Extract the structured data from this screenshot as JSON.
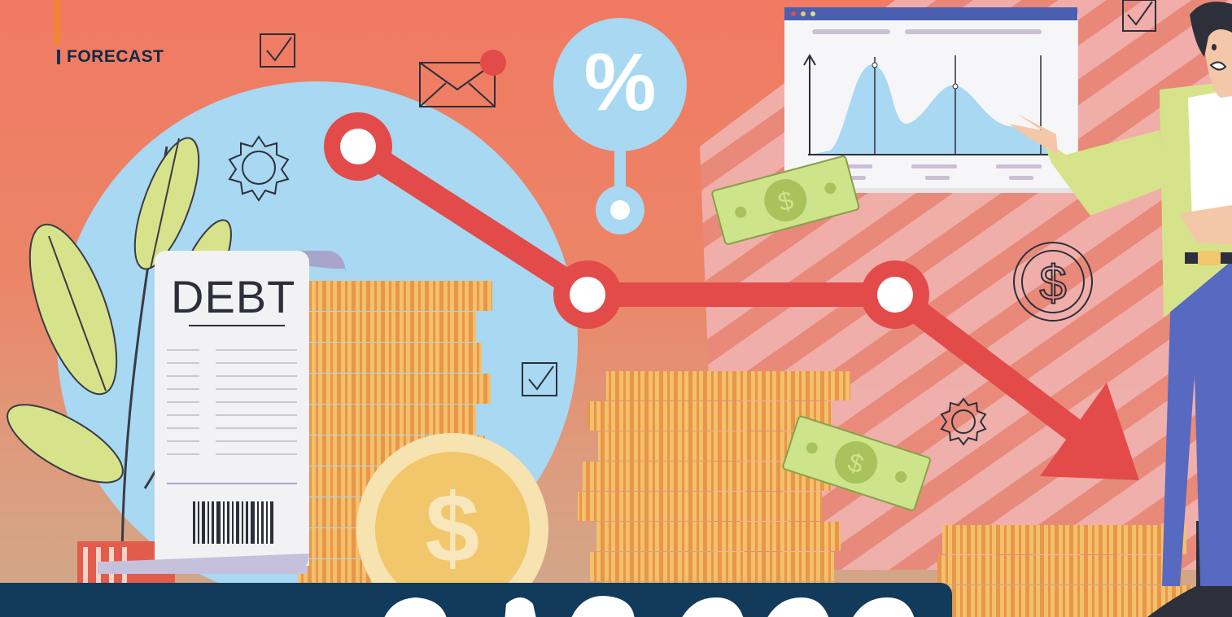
{
  "kicker": {
    "label": "FORECAST"
  },
  "receipt": {
    "title": "DEBT"
  },
  "colors": {
    "background_top": "#f07a62",
    "background_bottom": "#cfa98a",
    "trend_line": "#e24b4a",
    "banner": "#123a5a",
    "coin": "#f2c66a",
    "cash": "#cde48a",
    "leaf": "#d7e38a",
    "circle": "#a8d8f2"
  },
  "icons": [
    "check-icon",
    "envelope-icon",
    "percent-icon",
    "gear-icon",
    "dollar-icon",
    "barcode-icon"
  ]
}
